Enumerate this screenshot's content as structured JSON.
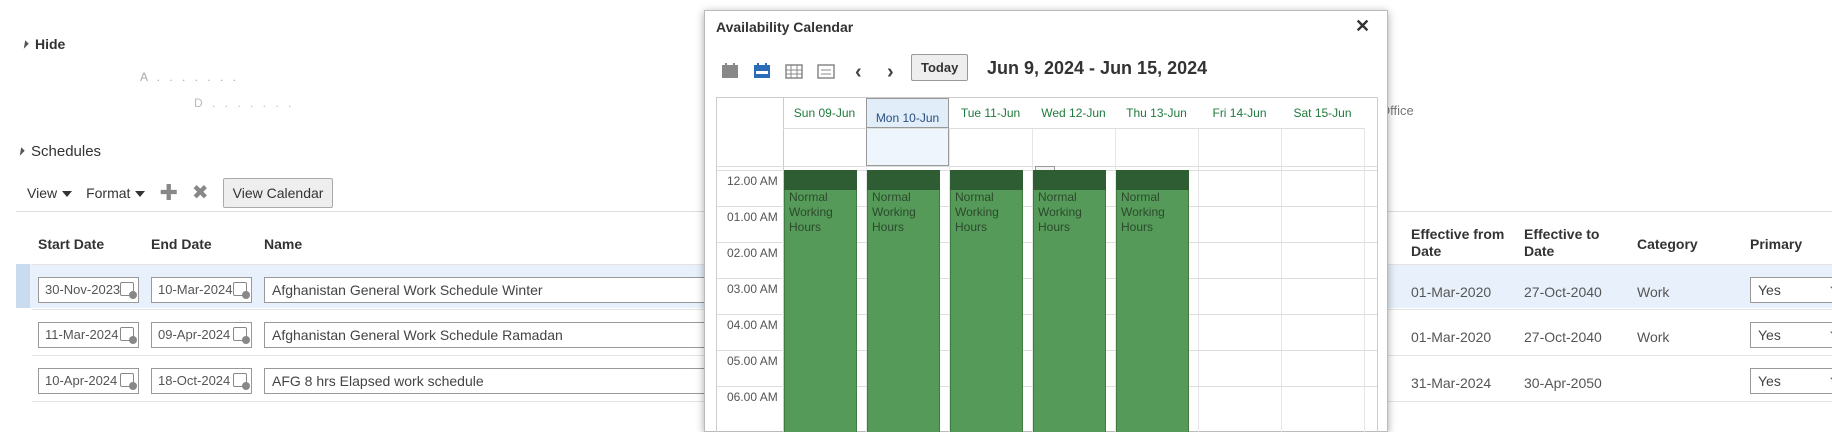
{
  "header": {
    "hide_label": "Hide",
    "obscured_1": "A  .  .  .  .  .  .  .",
    "obscured_2": "D  .  .  .  .  .  .  .",
    "office_fragment": "Office"
  },
  "schedules": {
    "title": "Schedules",
    "toolbar": {
      "view_label": "View",
      "format_label": "Format",
      "add_icon": "plus-icon",
      "delete_icon": "x-icon",
      "view_calendar_label": "View Calendar"
    },
    "columns": {
      "start": "Start Date",
      "end": "End Date",
      "name": "Name",
      "effective_from": "Effective from Date",
      "effective_to": "Effective to Date",
      "category": "Category",
      "primary": "Primary"
    },
    "rows": [
      {
        "start": "30-Nov-2023",
        "end": "10-Mar-2024",
        "name": "Afghanistan General Work Schedule Winter",
        "effective_from": "01-Mar-2020",
        "effective_to": "27-Oct-2040",
        "category": "Work",
        "primary": "Yes",
        "selected": true
      },
      {
        "start": "11-Mar-2024",
        "end": "09-Apr-2024",
        "name": "Afghanistan General Work Schedule Ramadan",
        "effective_from": "01-Mar-2020",
        "effective_to": "27-Oct-2040",
        "category": "Work",
        "primary": "Yes",
        "selected": false
      },
      {
        "start": "10-Apr-2024",
        "end": "18-Oct-2024",
        "name": "AFG 8 hrs Elapsed work schedule",
        "effective_from": "31-Mar-2024",
        "effective_to": "30-Apr-2050",
        "category": "",
        "primary": "Yes",
        "selected": false
      }
    ]
  },
  "dialog": {
    "title": "Availability Calendar",
    "close_icon": "close-icon",
    "view_icons": [
      "day-view-icon",
      "week-view-icon",
      "month-view-icon",
      "list-view-icon"
    ],
    "today_label": "Today",
    "range_label": "Jun 9, 2024 - Jun 15, 2024",
    "days": [
      "Sun 09-Jun",
      "Mon 10-Jun",
      "Tue 11-Jun",
      "Wed 12-Jun",
      "Thu 13-Jun",
      "Fri 14-Jun",
      "Sat 15-Jun"
    ],
    "selected_day": "Mon 10-Jun",
    "times": [
      "12.00 AM",
      "01.00 AM",
      "02.00 AM",
      "03.00 AM",
      "04.00 AM",
      "05.00 AM",
      "06.00 AM"
    ],
    "event_label_lines": [
      "Normal",
      "Working",
      "Hours"
    ],
    "event_days": [
      "Sun 09-Jun",
      "Mon 10-Jun",
      "Tue 11-Jun",
      "Wed 12-Jun",
      "Thu 13-Jun"
    ],
    "colors": {
      "event": "#569a59",
      "event_header": "#2f5d33",
      "day_header": "#1f7a3d",
      "selected_col": "#e1eef9"
    }
  }
}
